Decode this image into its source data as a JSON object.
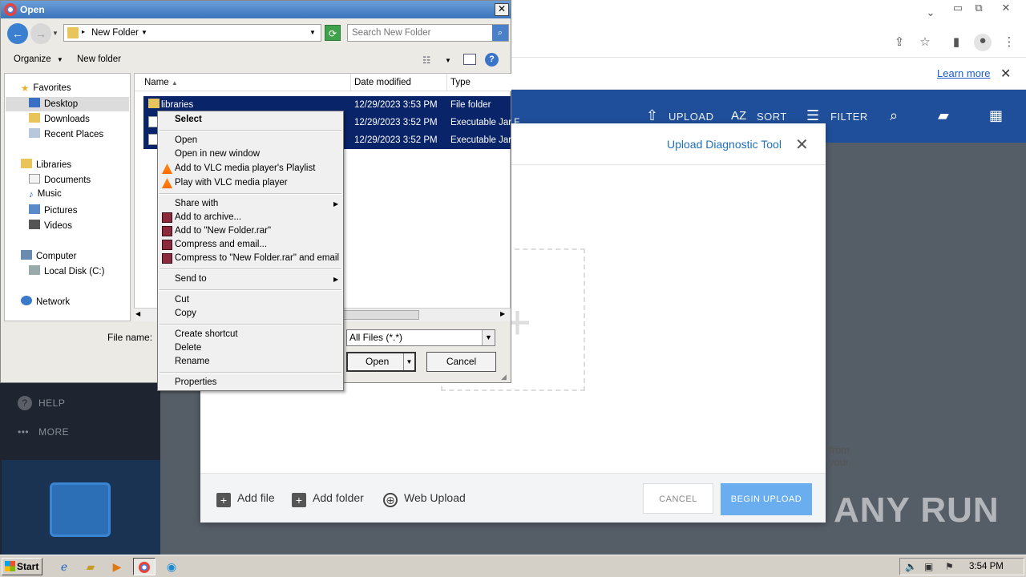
{
  "browser": {
    "infobar_link": "Learn more",
    "app_actions": {
      "upload": "UPLOAD",
      "sort": "SORT",
      "filter": "FILTER"
    },
    "sidebar": {
      "help": "HELP",
      "more": "MORE"
    }
  },
  "upload_dialog": {
    "title": "Upload Diagnostic Tool",
    "background_text": "from your",
    "add_file": "Add file",
    "add_folder": "Add folder",
    "web_upload": "Web Upload",
    "cancel": "CANCEL",
    "begin_upload": "BEGIN UPLOAD"
  },
  "watermark": "ANY RUN",
  "open_dialog": {
    "title": "Open",
    "address": "New Folder",
    "search_placeholder": "Search New Folder",
    "toolbar": {
      "organize": "Organize",
      "new_folder": "New folder"
    },
    "nav_pane": {
      "favorites": "Favorites",
      "desktop": "Desktop",
      "downloads": "Downloads",
      "recent_places": "Recent Places",
      "libraries": "Libraries",
      "documents": "Documents",
      "music": "Music",
      "pictures": "Pictures",
      "videos": "Videos",
      "computer": "Computer",
      "local_disk": "Local Disk (C:)",
      "network": "Network"
    },
    "columns": {
      "name": "Name",
      "date_modified": "Date modified",
      "type": "Type"
    },
    "files": [
      {
        "name": "libraries",
        "date": "12/29/2023 3:53 PM",
        "type": "File folder"
      },
      {
        "name": "",
        "date": "12/29/2023 3:52 PM",
        "type": "Executable Jar F"
      },
      {
        "name": "",
        "date": "12/29/2023 3:52 PM",
        "type": "Executable Jar F"
      }
    ],
    "file_name_label": "File name:",
    "file_type": "All Files (*.*)",
    "open_button": "Open",
    "cancel_button": "Cancel"
  },
  "context_menu": {
    "select": "Select",
    "open": "Open",
    "open_new_window": "Open in new window",
    "vlc_add": "Add to VLC media player's Playlist",
    "vlc_play": "Play with VLC media player",
    "share_with": "Share with",
    "add_archive": "Add to archive...",
    "add_rar": "Add to \"New Folder.rar\"",
    "compress_email": "Compress and email...",
    "compress_rar_email": "Compress to \"New Folder.rar\" and email",
    "send_to": "Send to",
    "cut": "Cut",
    "copy": "Copy",
    "create_shortcut": "Create shortcut",
    "delete": "Delete",
    "rename": "Rename",
    "properties": "Properties"
  },
  "taskbar": {
    "start": "Start",
    "clock": "3:54 PM"
  }
}
